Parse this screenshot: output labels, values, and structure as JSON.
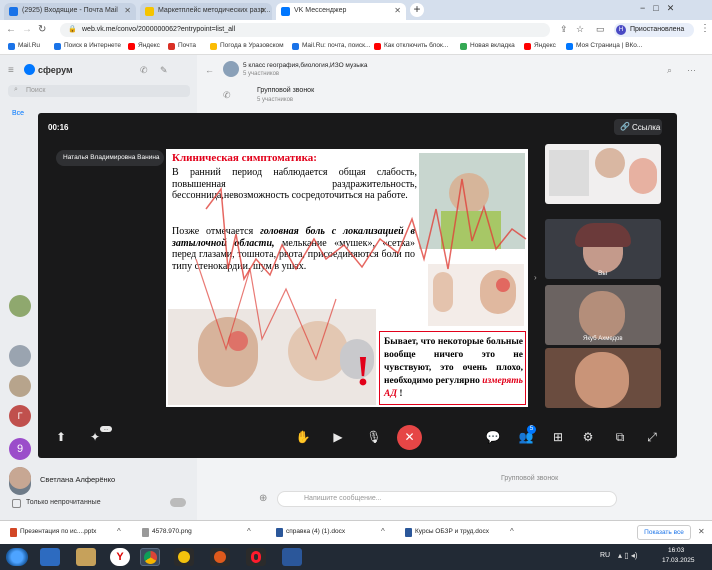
{
  "browser": {
    "tabs": [
      {
        "label": "(2925) Входящие - Почта Mail"
      },
      {
        "label": "Маркетплейс методических разр..."
      },
      {
        "label": "VK Мессенджер"
      }
    ],
    "url": "web.vk.me/convo/2000000062?entrypoint=list_all",
    "profile_label": "Приостановлена",
    "bookmarks": [
      {
        "label": "Mail.Ru"
      },
      {
        "label": "Поиск в Интернете"
      },
      {
        "label": "Яндекс"
      },
      {
        "label": "Почта"
      },
      {
        "label": "Погода в Уразовском"
      },
      {
        "label": "Mail.Ru: почта, поиск..."
      },
      {
        "label": "Как отключить блок..."
      },
      {
        "label": "Новая вкладка"
      },
      {
        "label": "Яндекс"
      },
      {
        "label": "Моя Страница | ВКо..."
      }
    ]
  },
  "vk": {
    "app_name": "сферум",
    "search_placeholder": "Поиск",
    "chat_title": "5 класс география,биология,ИЗО музыка",
    "chat_subtitle": "5 участников",
    "group_call_title": "Групповой звонок",
    "group_call_sub": "5 участников",
    "filter_all": "Все",
    "chat_list_name": "Светлана Алферёнко",
    "unread_toggle": "Только непрочитанные",
    "message_placeholder": "Напишите сообщение...",
    "group_call_msg": "Групповой звонок"
  },
  "call": {
    "timer": "00:16",
    "link_button": "Ссылка",
    "presenter_name": "Наталья Владимировна Ванина",
    "participants": [
      {
        "name": ""
      },
      {
        "name": "Вы"
      },
      {
        "name": "Якуб Ахмедов"
      },
      {
        "name": ""
      }
    ],
    "participants_badge": "5",
    "more_badge": "..."
  },
  "slide": {
    "heading": "Клиническая симптоматика:",
    "para1": "В ранний период наблюдается общая слабость, повышенная раздражительность, бессонница,невозможность сосредоточиться на работе.",
    "para2_a": "Позже отмечается ",
    "para2_b": "головная боль с локализацией в затылочной области,",
    "para2_c": " мелькание «мушек», «сетка» перед глазами, тошнота, рвота, присоединяются боли по типу стенокардии, шум в ушах.",
    "note_a": "Бывает, что некоторые больные вообще ничего это не чувствуют, это очень плохо, необходимо регулярно ",
    "note_b": "измерять АД",
    "note_c": " !"
  },
  "downloads": [
    {
      "label": "Презентация по ис....pptx"
    },
    {
      "label": "4578.970.png"
    },
    {
      "label": "справка (4) (1).docx"
    },
    {
      "label": "Курсы ОБЗР и труд.docx"
    }
  ],
  "downloads_show_all": "Показать все",
  "taskbar": {
    "lang": "RU",
    "time": "16:03",
    "date": "17.03.2025"
  },
  "colors": {
    "call_bg": "#19191a",
    "end_call": "#e64646",
    "slide_heading": "#e2001a",
    "slide_pen": "#e0413a",
    "vk_blue": "#0077ff"
  }
}
